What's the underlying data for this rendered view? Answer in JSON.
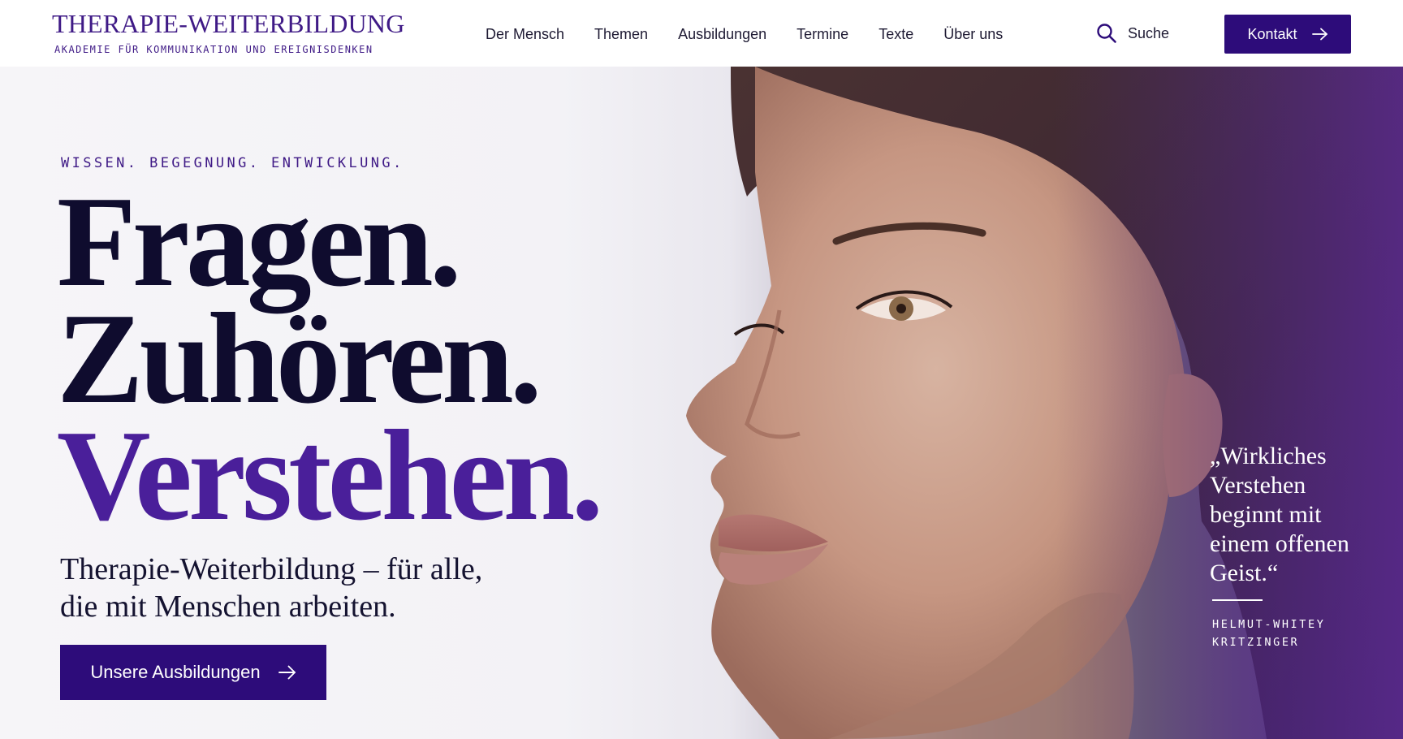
{
  "header": {
    "logo_title": "THERAPIE-WEITERBILDUNG",
    "logo_subtitle": "AKADEMIE FÜR KOMMUNIKATION UND EREIGNISDENKEN",
    "nav": [
      {
        "label": "Der Mensch"
      },
      {
        "label": "Themen"
      },
      {
        "label": "Ausbildungen"
      },
      {
        "label": "Termine"
      },
      {
        "label": "Texte"
      },
      {
        "label": "Über uns"
      }
    ],
    "search_label": "Suche",
    "search_icon": "search-icon",
    "contact_label": "Kontakt",
    "contact_icon": "arrow-right-icon"
  },
  "hero": {
    "eyebrow": "WISSEN. BEGEGNUNG. ENTWICKLUNG.",
    "headline": [
      "Fragen.",
      "Zuhören.",
      "Verstehen."
    ],
    "subline": [
      "Therapie-Weiterbildung – für alle,",
      "die mit Menschen arbeiten."
    ],
    "cta_label": "Unsere Ausbildungen",
    "cta_icon": "arrow-right-icon",
    "quote": "„Wirkliches Verstehen beginnt mit einem offenen Geist.“",
    "quote_author": "HELMUT-WHITEY KRITZINGER"
  },
  "colors": {
    "brand": "#3f1a86",
    "button": "#2d0c7a",
    "headline_dark": "#0f0c2e",
    "headline_accent": "#4a1f9a"
  }
}
